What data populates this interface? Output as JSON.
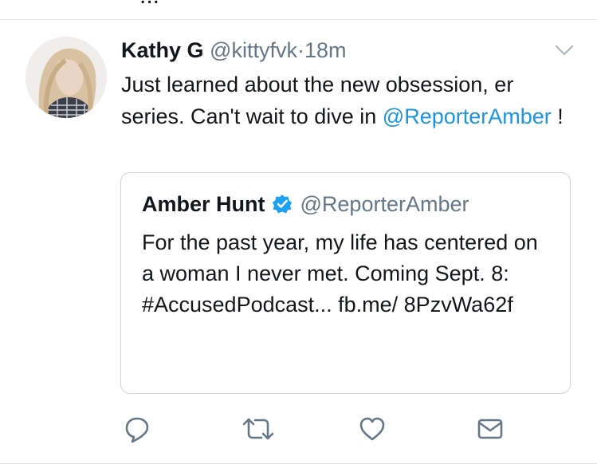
{
  "previous_tweet": {
    "text": "..."
  },
  "tweet": {
    "author": {
      "name": "Kathy G",
      "handle": "@kittyfvk"
    },
    "separator": "·",
    "time": "18m",
    "text_parts": [
      "Just learned about the new obsession, er series. Can't wait to dive in ",
      "@ReporterAmber",
      " !"
    ],
    "quoted": {
      "author": {
        "name": "Amber Hunt",
        "handle": "@ReporterAmber",
        "verified": true
      },
      "text": "For the past year, my life has centered on a woman I never met. Coming Sept. 8: #AccusedPodcast... fb.me/ 8PzvWa62f"
    },
    "actions": [
      "reply-icon",
      "retweet-icon",
      "like-icon",
      "message-icon"
    ]
  },
  "colors": {
    "link": "#1b95e0",
    "secondary": "#657786",
    "border": "#ccd6dd",
    "verified": "#1da1f2"
  }
}
